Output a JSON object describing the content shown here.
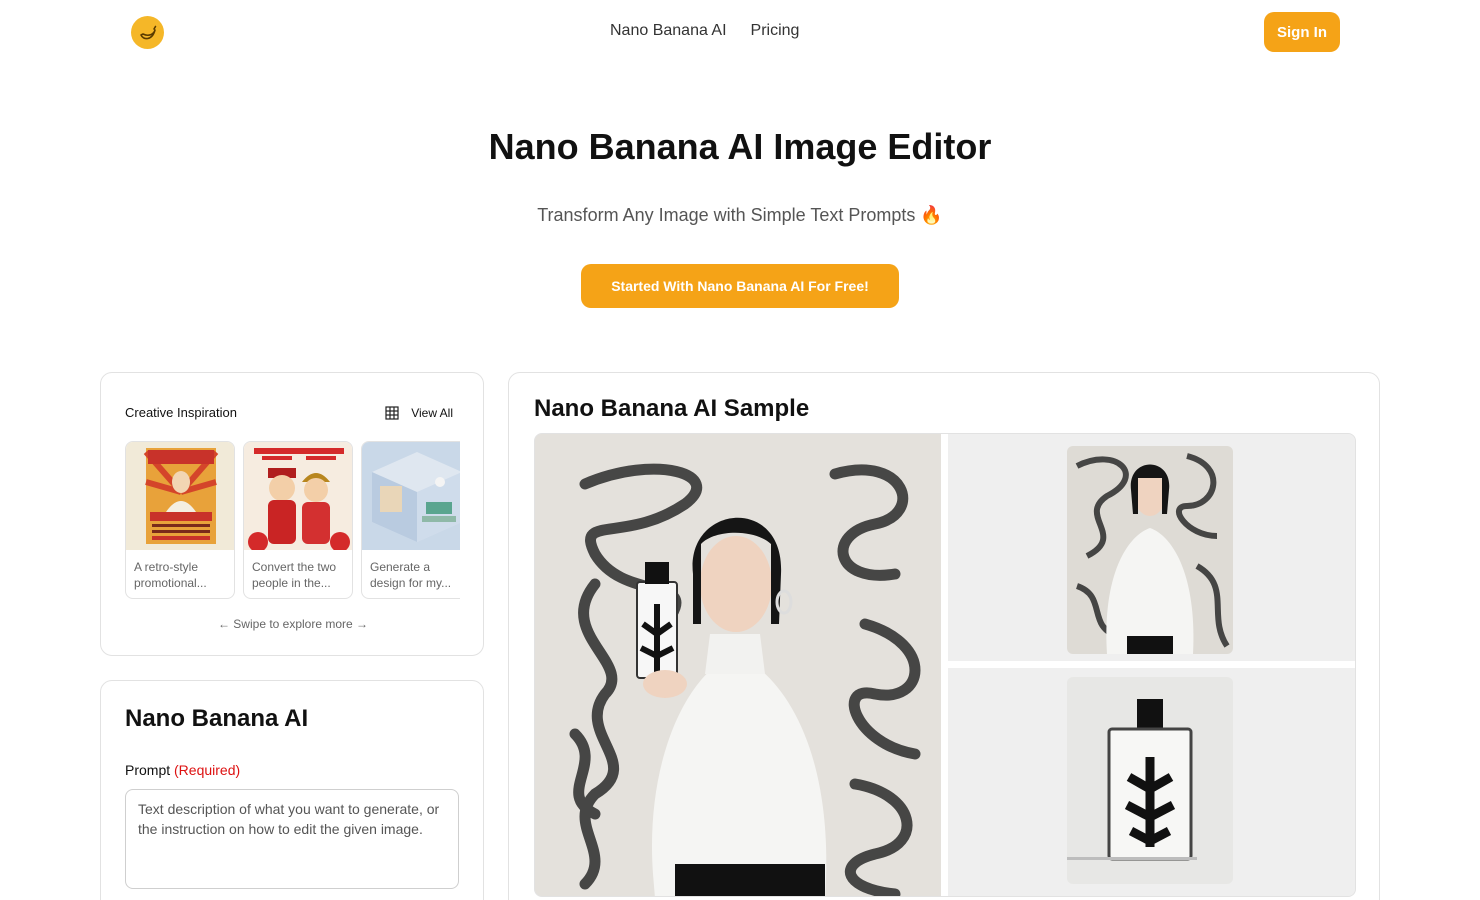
{
  "header": {
    "logo_icon": "banana-icon",
    "nav": [
      "Nano Banana AI",
      "Pricing"
    ],
    "signin_label": "Sign In"
  },
  "hero": {
    "title": "Nano Banana AI Image Editor",
    "subtitle": "Transform Any Image with Simple Text Prompts 🔥",
    "cta_label": "Started With Nano Banana AI For Free!"
  },
  "inspiration": {
    "title": "Creative Inspiration",
    "view_all_label": "View All",
    "view_all_icon": "grid-icon",
    "items": [
      {
        "line1": "A retro-style",
        "line2": "promotional..."
      },
      {
        "line1": "Convert the two",
        "line2": "people in the..."
      },
      {
        "line1": "Generate a",
        "line2": "design for my..."
      }
    ],
    "swipe_hint": "← Swipe to explore more →"
  },
  "form": {
    "title": "Nano Banana AI",
    "prompt_label": "Prompt",
    "prompt_required": "(Required)",
    "prompt_placeholder": "Text description of what you want to generate, or the instruction on how to edit the given image."
  },
  "sample": {
    "title": "Nano Banana AI Sample"
  },
  "colors": {
    "accent": "#f5a317",
    "logo": "#f5b728",
    "required": "#dd1111"
  }
}
